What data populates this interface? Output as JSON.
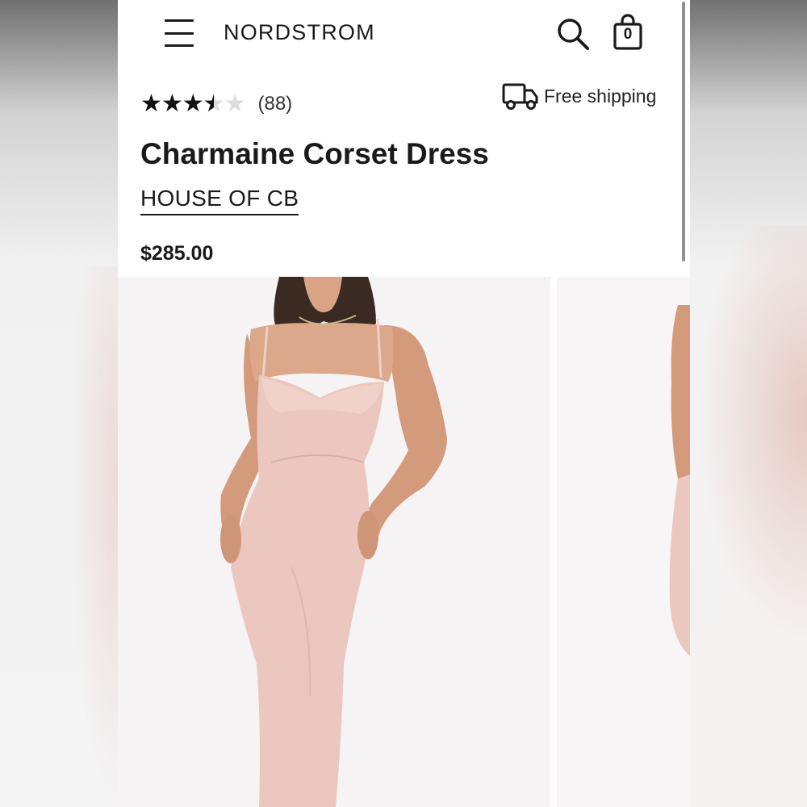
{
  "header": {
    "logo": "NORDSTROM",
    "menu_icon": "hamburger-menu-icon",
    "search_icon": "search-icon",
    "bag_icon": "shopping-bag-icon",
    "bag_count": "0"
  },
  "product": {
    "rating": 3.5,
    "rating_max": 5,
    "review_count": "(88)",
    "shipping_label": "Free shipping",
    "shipping_icon": "truck-icon",
    "title": "Charmaine Corset Dress",
    "brand": "HOUSE OF CB",
    "price": "$285.00"
  },
  "gallery": {
    "images": [
      "main-product-photo",
      "next-product-photo"
    ]
  },
  "colors": {
    "text": "#1a1a1a",
    "dress": "#ecc7c0",
    "skin": "#d79f82",
    "hair": "#3b2a22",
    "photo_bg": "#f5f3f3"
  }
}
